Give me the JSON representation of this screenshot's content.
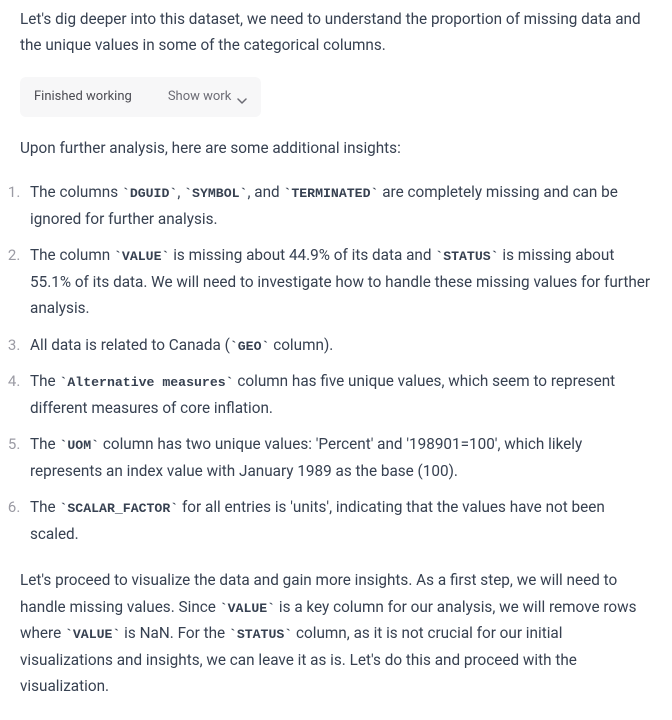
{
  "intro": "Let's dig deeper into this dataset, we need to understand the proportion of missing data and the unique values in some of the categorical columns.",
  "toggle": {
    "finished": "Finished working",
    "show": "Show work"
  },
  "summary": "Upon further analysis, here are some additional insights:",
  "items": [
    {
      "before": "The columns ",
      "code1": "`DGUID`",
      "mid1": ", ",
      "code2": "`SYMBOL`",
      "mid2": ", and ",
      "code3": "`TERMINATED`",
      "after": " are completely missing and can be ignored for further analysis."
    },
    {
      "before": "The column ",
      "code1": "`VALUE`",
      "mid1": " is missing about 44.9% of its data and ",
      "code2": "`STATUS`",
      "after": " is missing about 55.1% of its data. We will need to investigate how to handle these missing values for further analysis."
    },
    {
      "before": "All data is related to Canada (",
      "code1": "`GEO`",
      "after": " column)."
    },
    {
      "before": "The ",
      "code1": "`Alternative measures`",
      "after": " column has five unique values, which seem to represent different measures of core inflation."
    },
    {
      "before": "The ",
      "code1": "`UOM`",
      "after": " column has two unique values: 'Percent' and '198901=100', which likely represents an index value with January 1989 as the base (100)."
    },
    {
      "before": "The ",
      "code1": "`SCALAR_FACTOR`",
      "after": " for all entries is 'units', indicating that the values have not been scaled."
    }
  ],
  "closing": {
    "p1_a": "Let's proceed to visualize the data and gain more insights. As a first step, we will need to handle missing values. Since ",
    "c1": "`VALUE`",
    "p1_b": " is a key column for our analysis, we will remove rows where ",
    "c2": "`VALUE`",
    "p1_c": " is NaN. For the ",
    "c3": "`STATUS`",
    "p1_d": " column, as it is not crucial for our initial visualizations and insights, we can leave it as is. Let's do this and proceed with the visualization."
  }
}
